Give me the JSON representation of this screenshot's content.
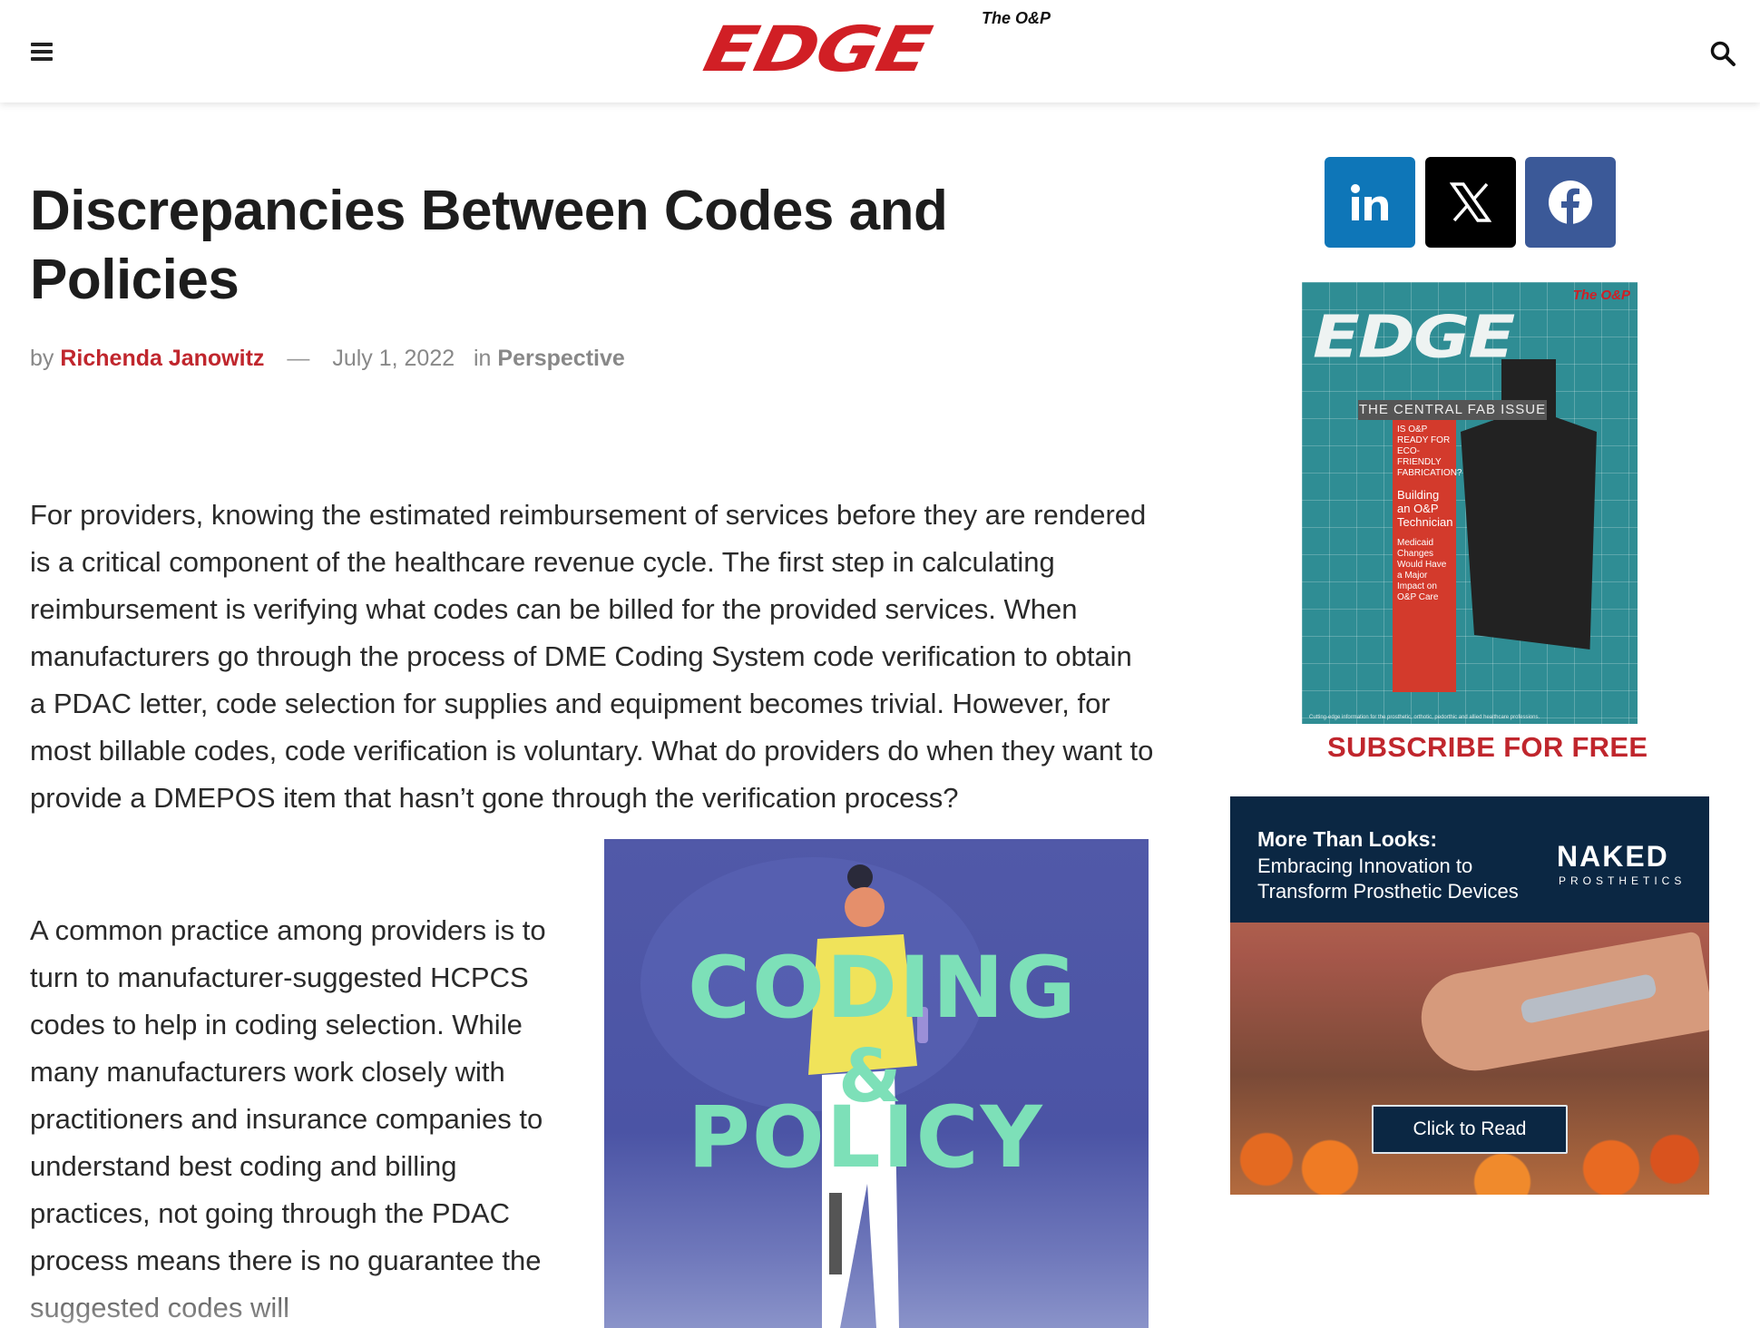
{
  "header": {
    "logo_small": "The O&P",
    "logo_main": "EDGE"
  },
  "article": {
    "title": "Discrepancies Between Codes and Policies",
    "byline_prefix": "by",
    "author": "Richenda Janowitz",
    "separator": "—",
    "date": "July 1, 2022",
    "in_label": "in",
    "category": "Perspective",
    "paragraph1": "For providers, knowing the estimated reimbursement of services before they are rendered is a critical component of the healthcare revenue cycle. The first step in calculating reimbursement is verifying what codes can be billed for the provided services. When manufacturers go through the process of DME Coding System code verification to obtain a PDAC letter, code selection for supplies and equipment becomes trivial. However, for most billable codes, code verification is voluntary. What do providers do when they want to provide a DMEPOS item that hasn’t gone through the verification process?",
    "paragraph2": "A common practice among providers is to turn to manufacturer-suggested HCPCS codes to help in coding selection. While many manufacturers work closely with practitioners and insurance companies to understand best coding and billing practices, not going through the PDAC process means there is no guarantee the suggested codes will",
    "image": {
      "word1": "CODING",
      "word2": "&",
      "word3": "POLICY"
    }
  },
  "sidebar": {
    "social": {
      "linkedin_icon": "linkedin-icon",
      "x_icon": "x-icon",
      "facebook_icon": "facebook-icon"
    },
    "magazine": {
      "small": "The O&P",
      "title": "EDGE",
      "issue": "THE CENTRAL FAB ISSUE",
      "teaser1": "IS O&P READY FOR ECO-FRIENDLY FABRICATION?",
      "teaser2": "Building an O&P Technician",
      "teaser3": "Medicaid Changes Would Have a Major Impact on O&P Care",
      "footer": "Cutting-edge information for the prosthetic, orthotic, pedorthic and allied healthcare professions."
    },
    "subscribe": "SUBSCRIBE FOR FREE",
    "ad": {
      "title": "More Than Looks:",
      "sub1": "Embracing Innovation to",
      "sub2": "Transform Prosthetic Devices",
      "brand": "NAKED",
      "brand_sub": "PROSTHETICS",
      "cta": "Click to Read"
    }
  },
  "colors": {
    "brand_red": "#d11f25",
    "linkedin": "#0e76b8",
    "facebook": "#3b5998",
    "ad_navy": "#0b2743"
  }
}
